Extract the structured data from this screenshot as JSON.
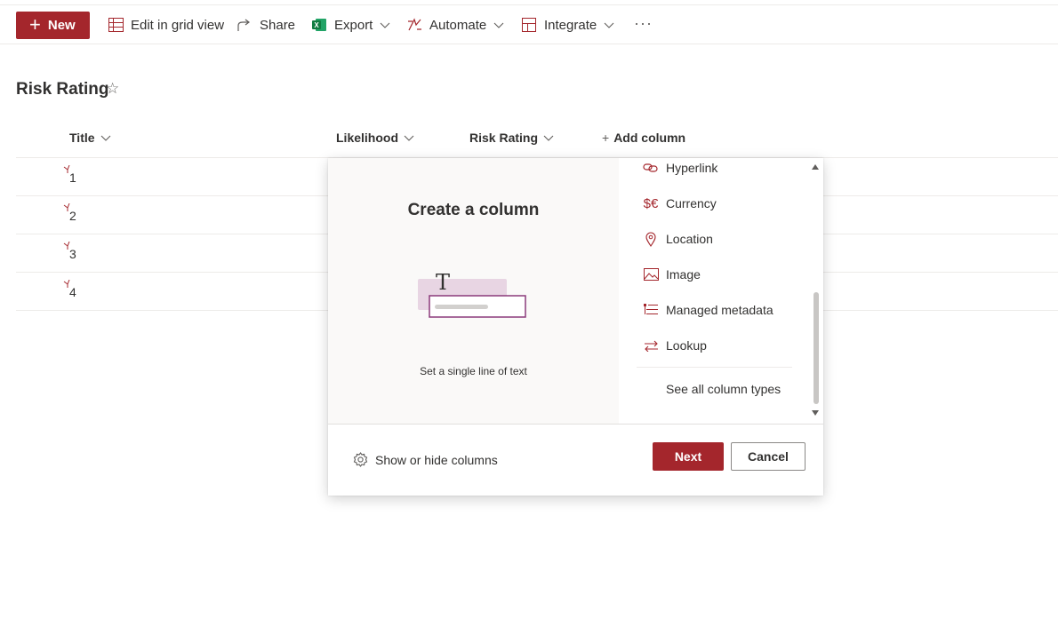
{
  "command_bar": {
    "new_label": "New",
    "edit_grid_label": "Edit in grid view",
    "share_label": "Share",
    "export_label": "Export",
    "automate_label": "Automate",
    "integrate_label": "Integrate",
    "more_label": "···"
  },
  "list": {
    "title": "Risk Rating",
    "favorite_icon": "☆",
    "columns": [
      "Title",
      "Likelihood",
      "Risk Rating"
    ],
    "add_column_label": "Add column",
    "rows": [
      {
        "title": "1"
      },
      {
        "title": "2"
      },
      {
        "title": "3"
      },
      {
        "title": "4"
      }
    ]
  },
  "panel": {
    "title": "Create a column",
    "preview_caption": "Set a single line of text",
    "column_types": [
      {
        "label": "Hyperlink",
        "icon": "link-icon"
      },
      {
        "label": "Currency",
        "icon": "currency-icon"
      },
      {
        "label": "Location",
        "icon": "location-pin-icon"
      },
      {
        "label": "Image",
        "icon": "image-icon"
      },
      {
        "label": "Managed metadata",
        "icon": "metadata-icon"
      },
      {
        "label": "Lookup",
        "icon": "lookup-arrows-icon"
      }
    ],
    "see_all_label": "See all column types",
    "show_hide_label": "Show or hide columns",
    "next_label": "Next",
    "cancel_label": "Cancel"
  },
  "colors": {
    "accent": "#a4262c",
    "text": "#323130",
    "preview_bg": "#faf9f8"
  }
}
